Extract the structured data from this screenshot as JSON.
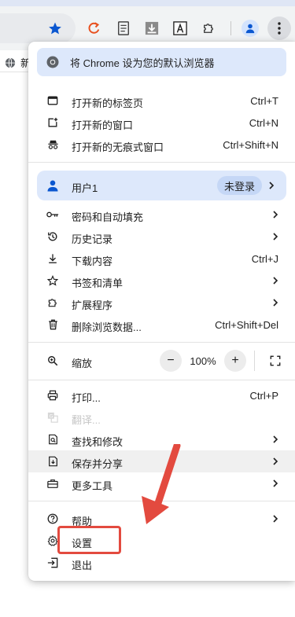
{
  "bookmark_bar": {
    "item_label": "新"
  },
  "menu": {
    "default_browser_banner": "将 Chrome 设为您的默认浏览器",
    "group1": [
      {
        "name": "new-tab",
        "label": "打开新的标签页",
        "shortcut": "Ctrl+T",
        "icon": "new-tab-icon"
      },
      {
        "name": "new-window",
        "label": "打开新的窗口",
        "shortcut": "Ctrl+N",
        "icon": "new-window-icon"
      },
      {
        "name": "incognito",
        "label": "打开新的无痕式窗口",
        "shortcut": "Ctrl+Shift+N",
        "icon": "incognito-icon"
      }
    ],
    "profile": {
      "name": "用户1",
      "status": "未登录"
    },
    "group2": [
      {
        "name": "passwords",
        "label": "密码和自动填充",
        "shortcut": "",
        "icon": "key-icon",
        "submenu": true
      },
      {
        "name": "history",
        "label": "历史记录",
        "shortcut": "",
        "icon": "history-icon",
        "submenu": true
      },
      {
        "name": "downloads",
        "label": "下载内容",
        "shortcut": "Ctrl+J",
        "icon": "download-icon",
        "submenu": false
      },
      {
        "name": "bookmarks",
        "label": "书签和清单",
        "shortcut": "",
        "icon": "star-icon",
        "submenu": true
      },
      {
        "name": "extensions",
        "label": "扩展程序",
        "shortcut": "",
        "icon": "puzzle-icon",
        "submenu": true
      },
      {
        "name": "clear-data",
        "label": "删除浏览数据...",
        "shortcut": "Ctrl+Shift+Del",
        "icon": "trash-icon",
        "submenu": false
      }
    ],
    "zoom": {
      "label": "缩放",
      "value": "100%",
      "minus": "−",
      "plus": "+"
    },
    "group3": [
      {
        "name": "print",
        "label": "打印...",
        "shortcut": "Ctrl+P",
        "icon": "print-icon",
        "submenu": false
      },
      {
        "name": "translate",
        "label": "翻译...",
        "shortcut": "",
        "icon": "translate-icon",
        "submenu": false,
        "disabled": true
      },
      {
        "name": "find-edit",
        "label": "查找和修改",
        "shortcut": "",
        "icon": "find-icon",
        "submenu": true
      },
      {
        "name": "save-share",
        "label": "保存并分享",
        "shortcut": "",
        "icon": "save-share-icon",
        "submenu": true
      },
      {
        "name": "more-tools",
        "label": "更多工具",
        "shortcut": "",
        "icon": "toolbox-icon",
        "submenu": true
      }
    ],
    "group4": [
      {
        "name": "help",
        "label": "帮助",
        "icon": "help-icon",
        "submenu": true
      },
      {
        "name": "settings",
        "label": "设置",
        "icon": "gear-icon",
        "submenu": false
      },
      {
        "name": "exit",
        "label": "退出",
        "icon": "exit-icon",
        "submenu": false
      }
    ]
  },
  "annotation": {
    "highlight_color": "#e34a3f"
  }
}
